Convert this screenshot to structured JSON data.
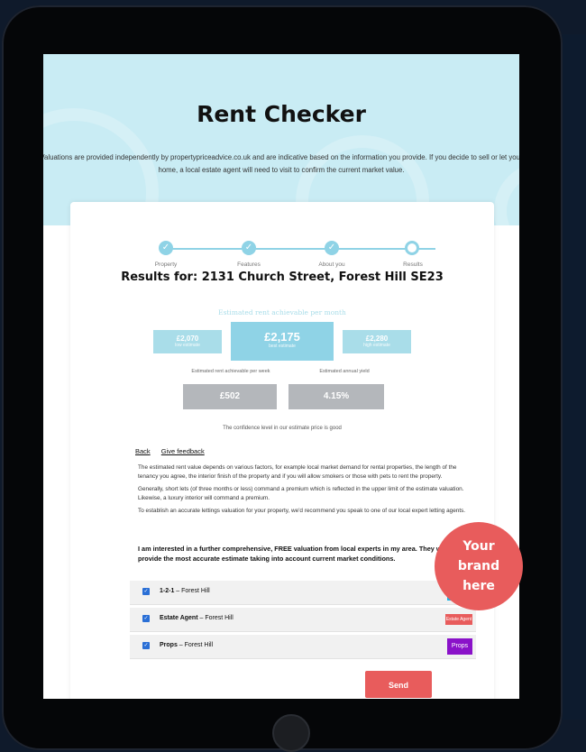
{
  "hero": {
    "title": "Rent Checker",
    "disclaimer": "Valuations are provided independently by propertypriceadvice.co.uk and are indicative based on the information you provide. If you decide to sell or let your home, a local estate agent will need to visit to confirm the current market value."
  },
  "stepper": {
    "steps": [
      {
        "label": "Property",
        "done": true
      },
      {
        "label": "Features",
        "done": true
      },
      {
        "label": "About you",
        "done": true
      },
      {
        "label": "Results",
        "done": false
      }
    ]
  },
  "results": {
    "title": "Results for: 2131 Church Street, Forest Hill SE23",
    "estimate_heading": "Estimated rent achievable per month",
    "low": {
      "value": "£2,070",
      "label": "low estimate"
    },
    "best": {
      "value": "£2,175",
      "label": "best estimate"
    },
    "high": {
      "value": "£2,280",
      "label": "high estimate"
    },
    "weekly_label": "Estimated rent achievable per week",
    "weekly_value": "£502",
    "yield_label": "Estimated annual yield",
    "yield_value": "4.15%",
    "confidence": "The confidence level in our estimate price is good"
  },
  "links": {
    "back": "Back",
    "feedback": "Give feedback"
  },
  "info": {
    "p1": "The estimated rent value depends on various factors, for example local market demand for rental properties, the length of the tenancy you agree, the interior finish of the property and if you will allow smokers or those with pets to rent the property.",
    "p2": "Generally, short lets (of three months or less) command a premium which is reflected in the upper limit of the estimate valuation. Likewise, a luxury interior will command a premium.",
    "p3": "To establish an accurate lettings valuation for your property, we'd recommend you speak to one of our local expert letting agents."
  },
  "interest": "I am interested in a further comprehensive, FREE valuation from local experts in my area. They will provide the most accurate estimate taking into account current market conditions.",
  "agents": [
    {
      "name": "1-2-1",
      "area": "– Forest Hill",
      "logo_text": "1-2-1",
      "logo_color": "#17b5e8"
    },
    {
      "name": "Estate Agent",
      "area": "– Forest Hill",
      "logo_text": "Estate Agent",
      "logo_color": "#e85c5c"
    },
    {
      "name": "Props",
      "area": "– Forest Hill",
      "logo_text": "Props",
      "logo_color": "#8a12c9"
    }
  ],
  "send_label": "Send",
  "badge": {
    "line1": "Your",
    "line2": "brand",
    "line3": "here"
  }
}
